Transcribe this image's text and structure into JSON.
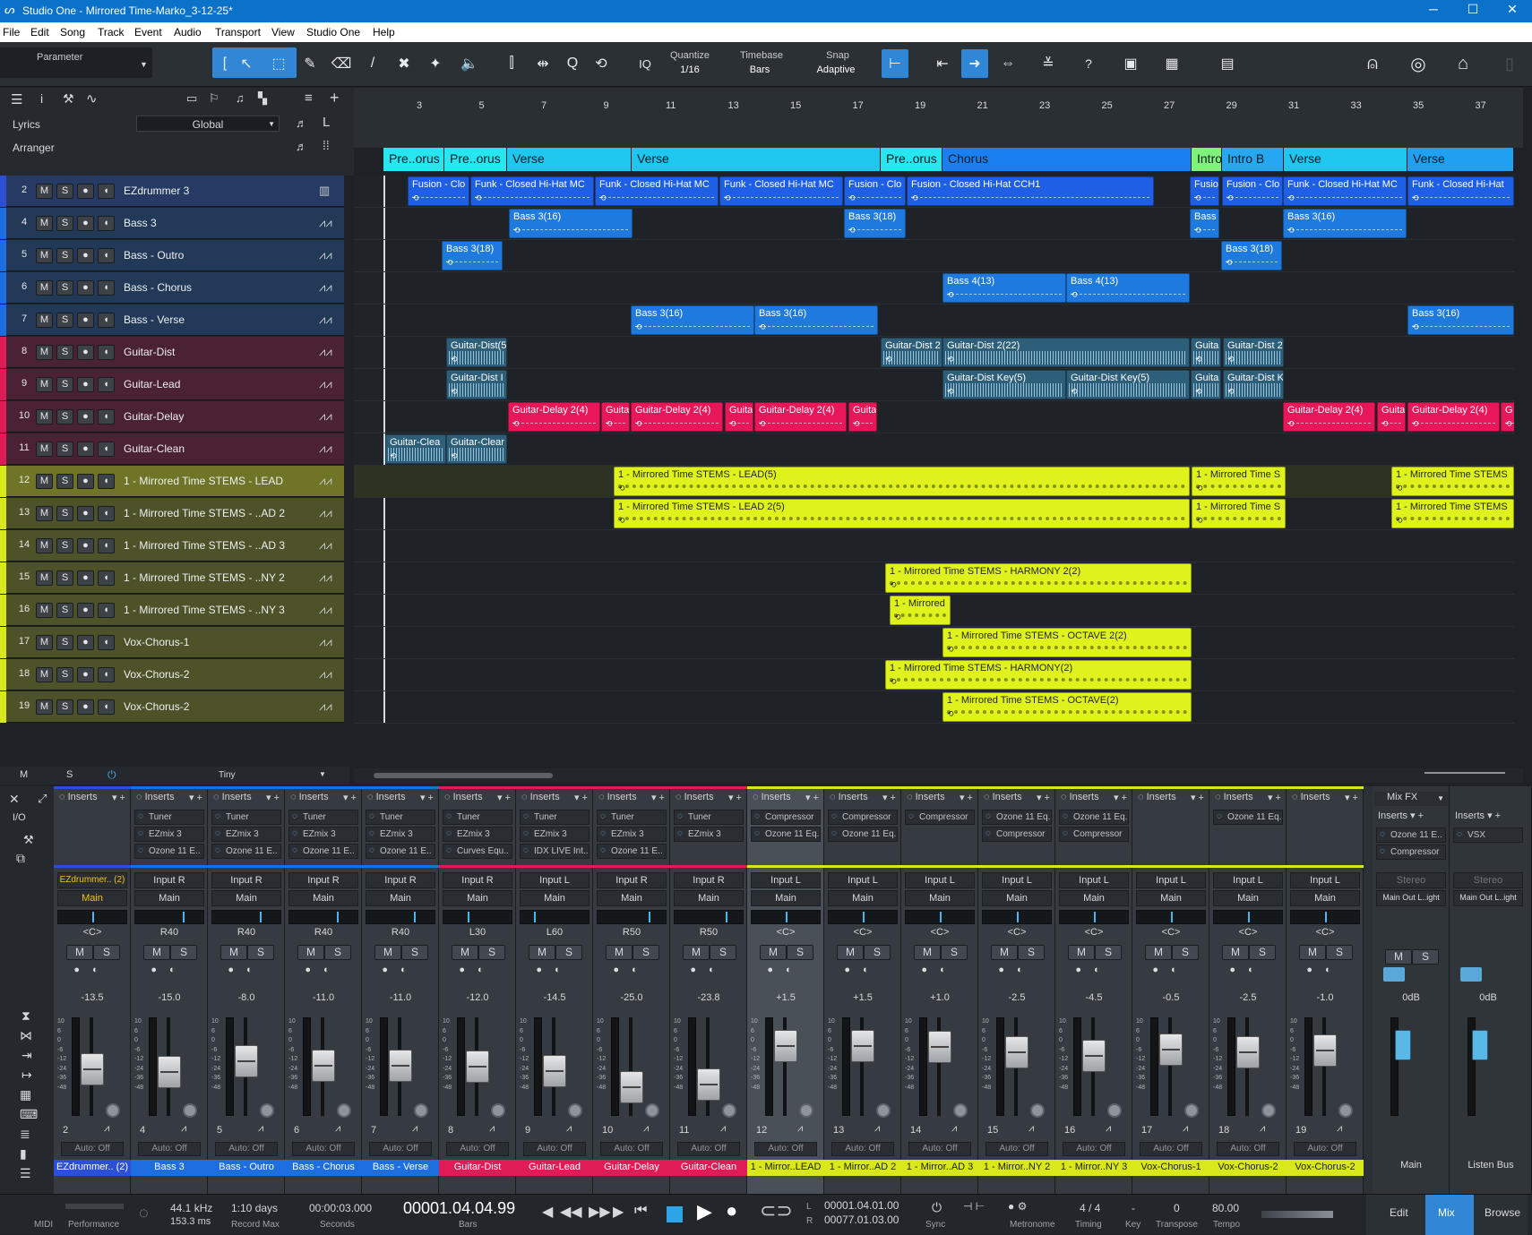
{
  "window": {
    "title": "Studio One - Mirrored Time-Marko_3-12-25*",
    "minimize": "─",
    "maximize": "☐",
    "close": "✕"
  },
  "menu": [
    "File",
    "Edit",
    "Song",
    "Track",
    "Event",
    "Audio",
    "Transport",
    "View",
    "Studio One",
    "Help"
  ],
  "toolbar": {
    "parameter": "Parameter",
    "quantize_label": "Quantize",
    "quantize_value": "1/16",
    "timebase_label": "Timebase",
    "timebase_value": "Bars",
    "snap_label": "Snap",
    "snap_value": "Adaptive",
    "iq": "IQ",
    "help": "?"
  },
  "lefthead": {
    "lyrics": "Lyrics",
    "global": "Global",
    "arranger": "Arranger"
  },
  "ruler": [
    "3",
    "5",
    "7",
    "9",
    "11",
    "13",
    "15",
    "17",
    "19",
    "21",
    "23",
    "25",
    "27",
    "29",
    "31",
    "33",
    "35",
    "37"
  ],
  "arranger": [
    {
      "label": "Pre..orus",
      "color": "#27e6f0"
    },
    {
      "label": "Pre..orus",
      "color": "#27e6f0"
    },
    {
      "label": "Verse",
      "color": "#1fc6ee"
    },
    {
      "label": "Verse",
      "color": "#1fc6ee"
    },
    {
      "label": "Pre..orus",
      "color": "#27e6f0"
    },
    {
      "label": "Chorus",
      "color": "#1a7ff0"
    },
    {
      "label": "Intro",
      "color": "#7ef27a"
    },
    {
      "label": "Intro B",
      "color": "#26a8f0"
    },
    {
      "label": "Verse",
      "color": "#1fc6ee"
    },
    {
      "label": "Verse",
      "color": "#1fa0f0"
    }
  ],
  "tracks": [
    {
      "num": "2",
      "name": "EZdrummer 3",
      "color": "#2b4fd6",
      "bg": "#263a63",
      "instrument": true
    },
    {
      "num": "4",
      "name": "Bass 3",
      "color": "#1d6fe0",
      "bg": "#223a58"
    },
    {
      "num": "5",
      "name": "Bass - Outro",
      "color": "#1d6fe0",
      "bg": "#223a58"
    },
    {
      "num": "6",
      "name": "Bass - Chorus",
      "color": "#1d6fe0",
      "bg": "#223a58"
    },
    {
      "num": "7",
      "name": "Bass - Verse",
      "color": "#1d6fe0",
      "bg": "#223a58"
    },
    {
      "num": "8",
      "name": "Guitar-Dist",
      "color": "#e01c56",
      "bg": "#4a2233"
    },
    {
      "num": "9",
      "name": "Guitar-Lead",
      "color": "#e01c56",
      "bg": "#4a2233"
    },
    {
      "num": "10",
      "name": "Guitar-Delay",
      "color": "#e01c56",
      "bg": "#4a2233"
    },
    {
      "num": "11",
      "name": "Guitar-Clean",
      "color": "#e01c56",
      "bg": "#4a2233"
    },
    {
      "num": "12",
      "name": "1 - Mirrored Time STEMS - LEAD",
      "color": "#d8e81a",
      "bg": "#6f7426",
      "selected": true
    },
    {
      "num": "13",
      "name": "1 - Mirrored Time STEMS - ..AD 2",
      "color": "#d8e81a",
      "bg": "#4e5228"
    },
    {
      "num": "14",
      "name": "1 - Mirrored Time STEMS - ..AD 3",
      "color": "#d8e81a",
      "bg": "#4e5228"
    },
    {
      "num": "15",
      "name": "1 - Mirrored Time STEMS - ..NY 2",
      "color": "#d8e81a",
      "bg": "#4e5228"
    },
    {
      "num": "16",
      "name": "1 - Mirrored Time STEMS - ..NY 3",
      "color": "#d8e81a",
      "bg": "#4e5228"
    },
    {
      "num": "17",
      "name": "Vox-Chorus-1",
      "color": "#d8e81a",
      "bg": "#4e5228"
    },
    {
      "num": "18",
      "name": "Vox-Chorus-2",
      "color": "#d8e81a",
      "bg": "#4e5228"
    },
    {
      "num": "19",
      "name": "Vox-Chorus-2",
      "color": "#d8e81a",
      "bg": "#4e5228"
    }
  ],
  "trackbuttons": {
    "m": "M",
    "s": "S",
    "rec": "●",
    "mon": "◖"
  },
  "clips": {
    "drums": [
      "Fusion - Clo",
      "Funk - Closed Hi-Hat MC",
      "Funk - Closed Hi-Hat MC",
      "Funk - Closed Hi-Hat MC",
      "Fusion - Clo",
      "Fusion - Closed Hi-Hat CCH1",
      "Fusio",
      "Fusion - Clo",
      "Funk - Closed Hi-Hat MC",
      "Funk - Closed Hi-Hat"
    ],
    "bass3": [
      "Bass 3(16)",
      "Bass 3(18)",
      "Bass",
      "Bass 3(16)"
    ],
    "bassout": [
      "Bass 3(18)",
      "Bass 3(18)"
    ],
    "basschorus": [
      "Bass 4(13)",
      "Bass 4(13)"
    ],
    "bassverse": [
      "Bass 3(16)",
      "Bass 3(16)",
      "Bass 3(16)"
    ],
    "gdist": [
      "Guitar-Dist(5",
      "Guitar-Dist 2",
      "Guitar-Dist 2(22)",
      "Guita",
      "Guitar-Dist 2"
    ],
    "glead": [
      "Guitar-Dist I",
      "Guitar-Dist Key(5)",
      "Guitar-Dist Key(5)",
      "Guita",
      "Guitar-Dist K"
    ],
    "gdelay": [
      "Guitar-Delay 2(4)",
      "Guita",
      "Guitar-Delay 2(4)",
      "Guita",
      "Guitar-Delay 2(4)",
      "Guita",
      "Guitar-Delay 2(4)",
      "Guita",
      "Guitar-Delay 2(4)",
      "G"
    ],
    "gclean": [
      "Guitar-Clea",
      "Guitar-Clear"
    ],
    "lead": [
      "1 - Mirrored Time STEMS - LEAD(5)",
      "1 - Mirrored Time S",
      "1 - Mirrored Time STEMS"
    ],
    "lead2": [
      "1 - Mirrored Time STEMS - LEAD 2(5)",
      "1 - Mirrored Time S",
      "1 - Mirrored Time STEMS"
    ],
    "harmony2": [
      "1 - Mirrored Time STEMS - HARMONY 2(2)"
    ],
    "harmony3": [
      "1 - Mirrored"
    ],
    "octave2": [
      "1 - Mirrored Time STEMS - OCTAVE  2(2)"
    ],
    "harmony": [
      "1 - Mirrored Time STEMS - HARMONY(2)"
    ],
    "octave": [
      "1 - Mirrored Time STEMS - OCTAVE(2)"
    ]
  },
  "trackfooter": {
    "m": "M",
    "s": "S",
    "size": "Tiny"
  },
  "console": {
    "io": "I/O",
    "strips": [
      {
        "color": "#2b4fd6",
        "inserts": [],
        "input": "EZdrummer.. (2)",
        "output": "Main",
        "pan": "<C>",
        "vol": "-13.5",
        "idx": "2",
        "name": "EZdrummer.. (2)",
        "pan_pos": 0.5
      },
      {
        "color": "#1d6fe0",
        "inserts": [
          "Tuner",
          "EZmix 3",
          "Ozone 11 E.."
        ],
        "input": "Input R",
        "output": "Main",
        "pan": "R40",
        "vol": "-15.0",
        "idx": "4",
        "name": "Bass 3",
        "pan_pos": 0.7
      },
      {
        "color": "#1d6fe0",
        "inserts": [
          "Tuner",
          "EZmix 3",
          "Ozone 11 E.."
        ],
        "input": "Input R",
        "output": "Main",
        "pan": "R40",
        "vol": "-8.0",
        "idx": "5",
        "name": "Bass - Outro",
        "pan_pos": 0.7
      },
      {
        "color": "#1d6fe0",
        "inserts": [
          "Tuner",
          "EZmix 3",
          "Ozone 11 E.."
        ],
        "input": "Input R",
        "output": "Main",
        "pan": "R40",
        "vol": "-11.0",
        "idx": "6",
        "name": "Bass - Chorus",
        "pan_pos": 0.7
      },
      {
        "color": "#1d6fe0",
        "inserts": [
          "Tuner",
          "EZmix 3",
          "Ozone 11 E.."
        ],
        "input": "Input R",
        "output": "Main",
        "pan": "R40",
        "vol": "-11.0",
        "idx": "7",
        "name": "Bass - Verse",
        "pan_pos": 0.7
      },
      {
        "color": "#e01c56",
        "inserts": [
          "Tuner",
          "EZmix 3",
          "Curves Equ.."
        ],
        "input": "Input R",
        "output": "Main",
        "pan": "L30",
        "vol": "-12.0",
        "idx": "8",
        "name": "Guitar-Dist",
        "pan_pos": 0.35
      },
      {
        "color": "#e01c56",
        "inserts": [
          "Tuner",
          "EZmix 3",
          "IDX LIVE Int.."
        ],
        "input": "Input L",
        "output": "Main",
        "pan": "L60",
        "vol": "-14.5",
        "idx": "9",
        "name": "Guitar-Lead",
        "pan_pos": 0.2
      },
      {
        "color": "#e01c56",
        "inserts": [
          "Tuner",
          "EZmix 3",
          "Ozone 11 E.."
        ],
        "input": "Input R",
        "output": "Main",
        "pan": "R50",
        "vol": "-25.0",
        "idx": "10",
        "name": "Guitar-Delay",
        "pan_pos": 0.75
      },
      {
        "color": "#e01c56",
        "inserts": [
          "Tuner",
          "EZmix 3"
        ],
        "input": "Input R",
        "output": "Main",
        "pan": "R50",
        "vol": "-23.8",
        "idx": "11",
        "name": "Guitar-Clean",
        "pan_pos": 0.75
      },
      {
        "color": "#d8e81a",
        "inserts": [
          "Compressor",
          "Ozone 11 Eq.."
        ],
        "input": "Input L",
        "output": "Main",
        "pan": "<C>",
        "vol": "+1.5",
        "idx": "12",
        "name": "1 - Mirror..LEAD",
        "pan_pos": 0.5,
        "selected": true
      },
      {
        "color": "#d8e81a",
        "inserts": [
          "Compressor",
          "Ozone 11 Eq.."
        ],
        "input": "Input L",
        "output": "Main",
        "pan": "<C>",
        "vol": "+1.5",
        "idx": "13",
        "name": "1 - Mirror..AD 2",
        "pan_pos": 0.5
      },
      {
        "color": "#d8e81a",
        "inserts": [
          "Compressor"
        ],
        "input": "Input L",
        "output": "Main",
        "pan": "<C>",
        "vol": "+1.0",
        "idx": "14",
        "name": "1 - Mirror..AD 3",
        "pan_pos": 0.5
      },
      {
        "color": "#d8e81a",
        "inserts": [
          "Ozone 11 Eq..",
          "Compressor"
        ],
        "input": "Input L",
        "output": "Main",
        "pan": "<C>",
        "vol": "-2.5",
        "idx": "15",
        "name": "1 - Mirror..NY 2",
        "pan_pos": 0.5
      },
      {
        "color": "#d8e81a",
        "inserts": [
          "Ozone 11 Eq..",
          "Compressor"
        ],
        "input": "Input L",
        "output": "Main",
        "pan": "<C>",
        "vol": "-4.5",
        "idx": "16",
        "name": "1 - Mirror..NY 3",
        "pan_pos": 0.5
      },
      {
        "color": "#d8e81a",
        "inserts": [],
        "input": "Input L",
        "output": "Main",
        "pan": "<C>",
        "vol": "-0.5",
        "idx": "17",
        "name": "Vox-Chorus-1",
        "pan_pos": 0.5
      },
      {
        "color": "#d8e81a",
        "inserts": [
          "Ozone 11 Eq.."
        ],
        "input": "Input L",
        "output": "Main",
        "pan": "<C>",
        "vol": "-2.5",
        "idx": "18",
        "name": "Vox-Chorus-2",
        "pan_pos": 0.5
      },
      {
        "color": "#d8e81a",
        "inserts": [],
        "input": "Input L",
        "output": "Main",
        "pan": "<C>",
        "vol": "-1.0",
        "idx": "19",
        "name": "Vox-Chorus-2",
        "pan_pos": 0.5
      }
    ],
    "inserts_label": "Inserts",
    "auto": "Auto: Off",
    "m": "M",
    "s": "S",
    "scale": [
      "10",
      "6",
      "0",
      "-6",
      "-12",
      "-24",
      "-36",
      "-48"
    ],
    "mixfx": "Mix FX",
    "main": {
      "label": "Main",
      "inserts": [
        "Ozone 11 E..",
        "Compressor"
      ],
      "stereo": "Stereo",
      "out": "Main Out L..ight",
      "vol": "0dB"
    },
    "listen": {
      "label": "Listen Bus",
      "inserts": [
        "VSX"
      ],
      "stereo": "Stereo",
      "out": "Main Out L..ight",
      "vol": "0dB"
    }
  },
  "transport": {
    "midi": "MIDI",
    "performance": "Performance",
    "rate": "44.1 kHz",
    "latency": "153.3 ms",
    "record": "1:10 days",
    "record_max": "Record Max",
    "seconds": "00:00:03.000",
    "seconds_label": "Seconds",
    "bars": "00001.04.04.99",
    "bars_label": "Bars",
    "loop_l": "00001.04.01.00",
    "loop_r": "00077.01.03.00",
    "l": "L",
    "r": "R",
    "sync": "Sync",
    "metronome": "Metronome",
    "timing": "4 / 4",
    "timing_label": "Timing",
    "key": "-",
    "key_label": "Key",
    "transpose": "0",
    "transpose_label": "Transpose",
    "tempo": "80.00",
    "tempo_label": "Tempo",
    "edit": "Edit",
    "mix": "Mix",
    "browse": "Browse"
  }
}
